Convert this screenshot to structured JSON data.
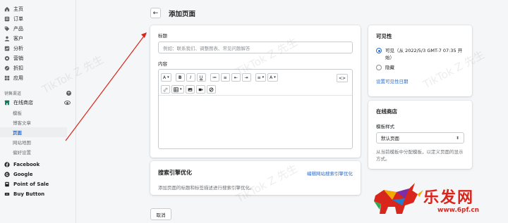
{
  "sidebar": {
    "nav": [
      {
        "label": "主页",
        "icon": "home-icon"
      },
      {
        "label": "订单",
        "icon": "orders-icon"
      },
      {
        "label": "产品",
        "icon": "tag-icon"
      },
      {
        "label": "客户",
        "icon": "customer-icon"
      },
      {
        "label": "分析",
        "icon": "analytics-icon"
      },
      {
        "label": "营销",
        "icon": "marketing-icon"
      },
      {
        "label": "折扣",
        "icon": "discount-icon"
      },
      {
        "label": "应用",
        "icon": "apps-icon"
      }
    ],
    "channels_title": "销售渠道",
    "online_store": "在线商店",
    "sub_items": [
      "模板",
      "博客文章",
      "页面",
      "网站地图",
      "偏好设置"
    ],
    "active_sub": "页面",
    "channels": [
      {
        "label": "Facebook",
        "icon": "facebook-icon"
      },
      {
        "label": "Google",
        "icon": "google-icon"
      },
      {
        "label": "Point of Sale",
        "icon": "pos-icon"
      },
      {
        "label": "Buy Button",
        "icon": "buy-button-icon"
      }
    ]
  },
  "header": {
    "back_symbol": "←",
    "title": "添加页面"
  },
  "form": {
    "title_label": "标题",
    "title_placeholder": "例如：联系我们、调整图表、常见问题解答",
    "content_label": "内容",
    "toolbar_row1": [
      "A",
      "B",
      "I",
      "U",
      "≔",
      "≡",
      "⇤",
      "⇥",
      "≡",
      "A"
    ],
    "code_button": "<>"
  },
  "seo": {
    "title": "搜索引擎优化",
    "edit_link": "编辑网站搜索引擎优化",
    "description": "添加页面的标题和标签描述进行搜索引擎优化。"
  },
  "actions": {
    "cancel": "取消"
  },
  "visibility": {
    "title": "可见性",
    "visible_label": "可见（从 2022/5/3 GMT-7 07:35 开始）",
    "hidden_label": "隐藏",
    "selected": "visible",
    "set_date_link": "设置可见性日期"
  },
  "online_store": {
    "title": "在线商店",
    "template_label": "模板样式",
    "template_value": "默认页面",
    "template_desc": "从当前模板中分配模板，以定义页面的显示方式。"
  },
  "watermark": "TikTok Z 先生",
  "branding": {
    "name": "乐发网",
    "url": "www.6pf.cn"
  },
  "colors": {
    "accent": "#2c6ecb",
    "arrow": "#d9261c",
    "brand_red": "#d9261c"
  }
}
